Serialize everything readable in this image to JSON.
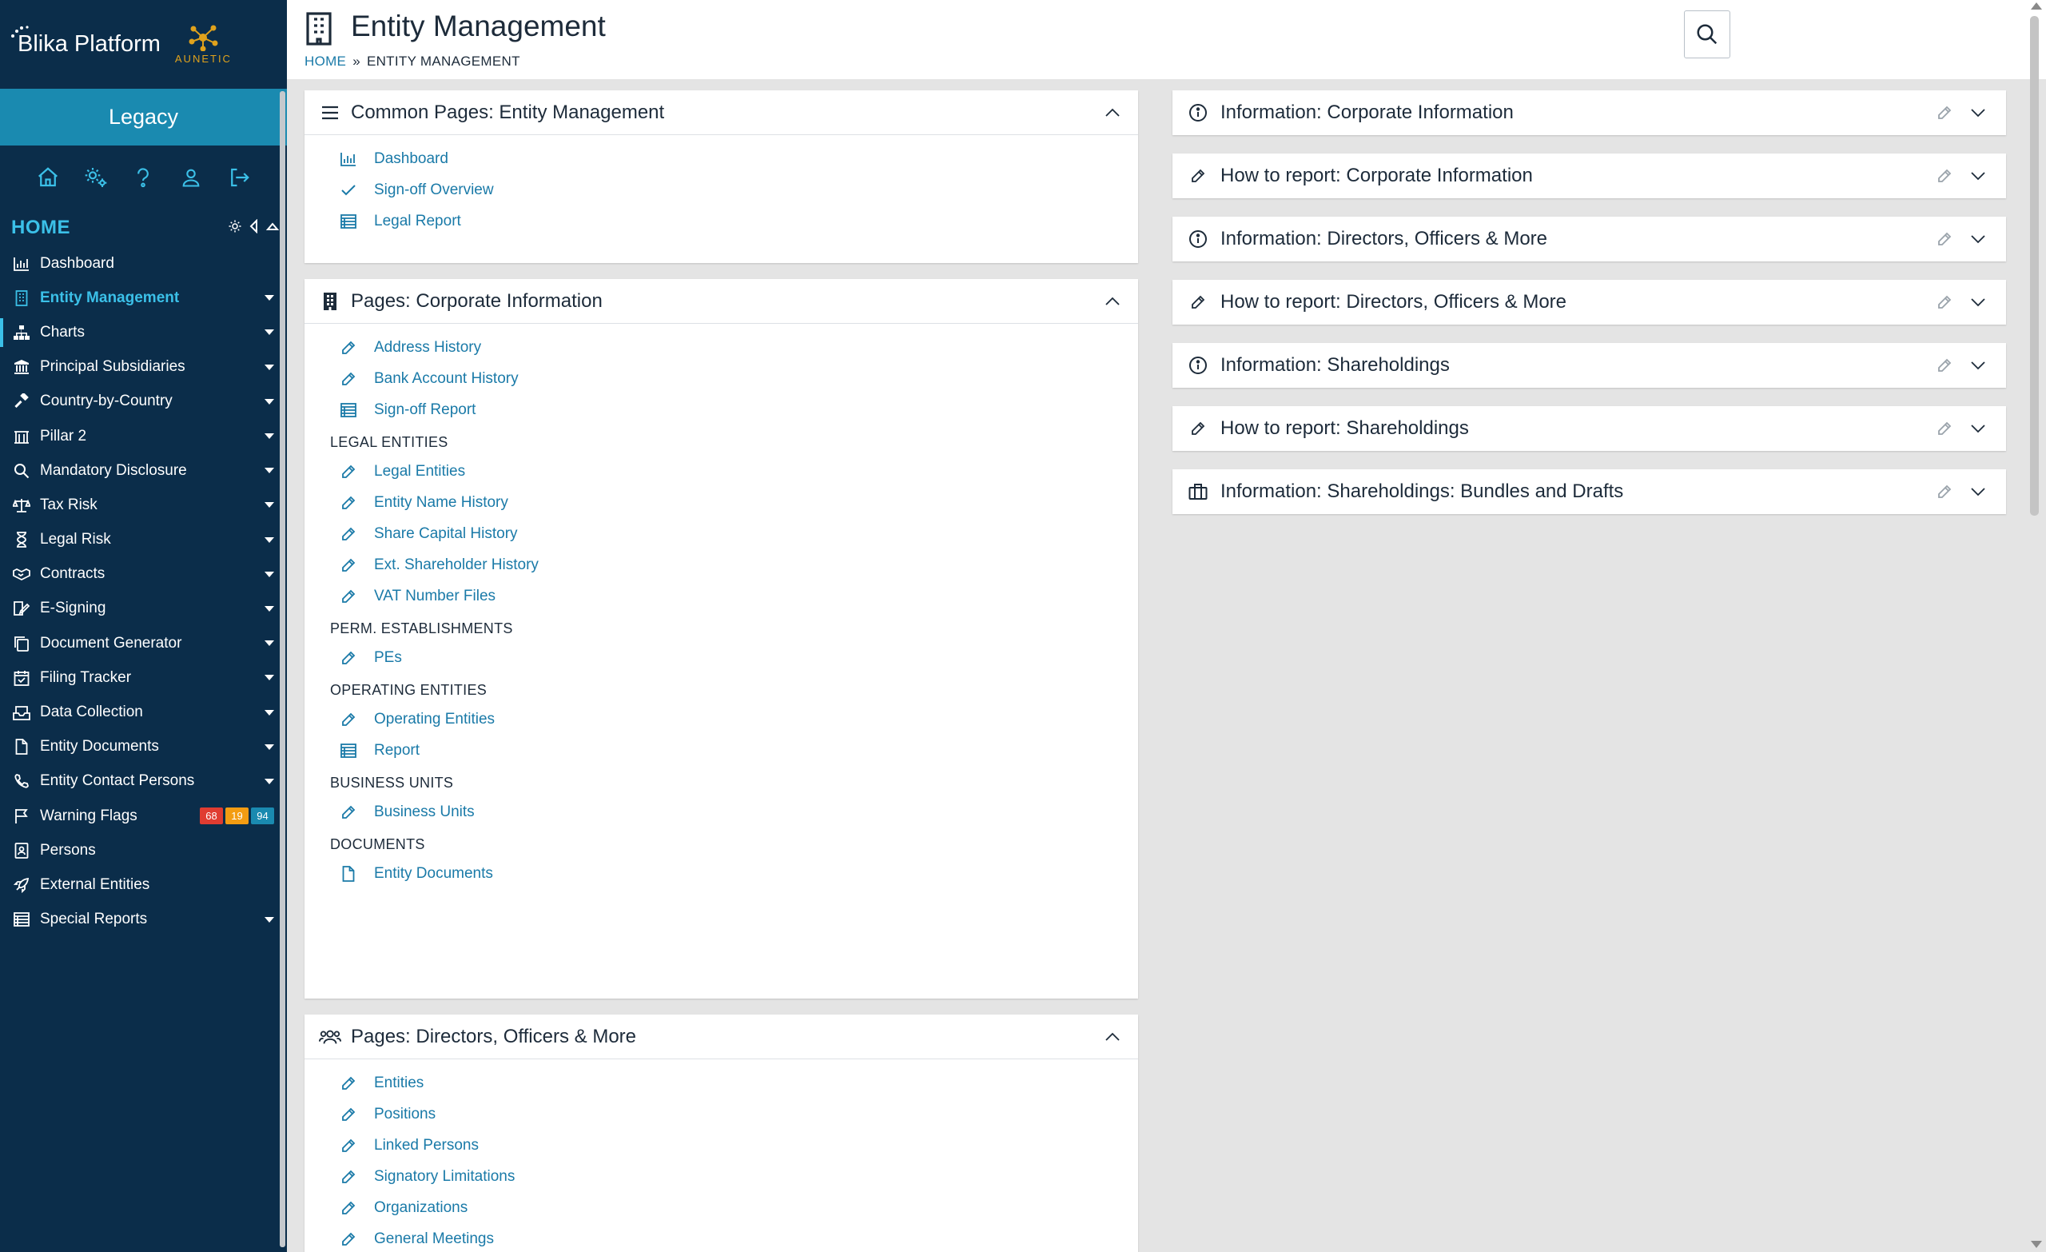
{
  "app": {
    "logo_text": "Blika Platform",
    "partner_logo_text": "AUNETIC",
    "environment_label": "Legacy"
  },
  "colors": {
    "sidebar_bg": "#0b2d4a",
    "legacy_bar": "#1a8ab0",
    "accent": "#3bc0e8",
    "link": "#1a7aa8",
    "badge_red": "#e03c31",
    "badge_orange": "#f39c12",
    "badge_blue": "#1a8ab0"
  },
  "sidebar": {
    "top_icons": [
      "home-icon",
      "settings-icon",
      "help-icon",
      "user-icon",
      "logout-icon"
    ],
    "home_label": "HOME",
    "items": [
      {
        "label": "Dashboard",
        "icon": "chart-icon",
        "expandable": false
      },
      {
        "label": "Entity Management",
        "icon": "building-icon",
        "expandable": true,
        "active": true
      },
      {
        "label": "Charts",
        "icon": "org-chart-icon",
        "expandable": true
      },
      {
        "label": "Principal Subsidiaries",
        "icon": "bank-icon",
        "expandable": true
      },
      {
        "label": "Country-by-Country",
        "icon": "gavel-icon",
        "expandable": true
      },
      {
        "label": "Pillar 2",
        "icon": "pillar-icon",
        "expandable": true
      },
      {
        "label": "Mandatory Disclosure",
        "icon": "magnifier-icon",
        "expandable": true
      },
      {
        "label": "Tax Risk",
        "icon": "scales-icon",
        "expandable": true
      },
      {
        "label": "Legal Risk",
        "icon": "hourglass-icon",
        "expandable": true
      },
      {
        "label": "Contracts",
        "icon": "handshake-icon",
        "expandable": true
      },
      {
        "label": "E-Signing",
        "icon": "sign-icon",
        "expandable": true
      },
      {
        "label": "Document Generator",
        "icon": "copy-icon",
        "expandable": true
      },
      {
        "label": "Filing Tracker",
        "icon": "calendar-icon",
        "expandable": true
      },
      {
        "label": "Data Collection",
        "icon": "inbox-icon",
        "expandable": true
      },
      {
        "label": "Entity Documents",
        "icon": "file-icon",
        "expandable": true
      },
      {
        "label": "Entity Contact Persons",
        "icon": "phone-icon",
        "expandable": true
      },
      {
        "label": "Warning Flags",
        "icon": "flag-icon",
        "expandable": false,
        "badges": [
          "68",
          "19",
          "94"
        ]
      },
      {
        "label": "Persons",
        "icon": "id-card-icon",
        "expandable": false
      },
      {
        "label": "External Entities",
        "icon": "rocket-icon",
        "expandable": false
      },
      {
        "label": "Special Reports",
        "icon": "table-icon",
        "expandable": true
      }
    ]
  },
  "header": {
    "title": "Entity Management",
    "breadcrumb_home": "HOME",
    "breadcrumb_sep": "»",
    "breadcrumb_current": "ENTITY MANAGEMENT"
  },
  "panels": {
    "common": {
      "title": "Common Pages: Entity Management",
      "links": [
        {
          "label": "Dashboard",
          "icon": "chart-icon"
        },
        {
          "label": "Sign-off Overview",
          "icon": "check-icon"
        },
        {
          "label": "Legal Report",
          "icon": "table-icon"
        }
      ]
    },
    "corporate": {
      "title": "Pages: Corporate Information",
      "links": [
        {
          "label": "Address History",
          "icon": "pencil-icon"
        },
        {
          "label": "Bank Account History",
          "icon": "pencil-icon"
        },
        {
          "label": "Sign-off Report",
          "icon": "table-icon"
        }
      ],
      "sections": [
        {
          "label": "LEGAL ENTITIES",
          "links": [
            {
              "label": "Legal Entities",
              "icon": "pencil-icon"
            },
            {
              "label": "Entity Name History",
              "icon": "pencil-icon"
            },
            {
              "label": "Share Capital History",
              "icon": "pencil-icon"
            },
            {
              "label": "Ext. Shareholder History",
              "icon": "pencil-icon"
            },
            {
              "label": "VAT Number Files",
              "icon": "pencil-icon"
            }
          ]
        },
        {
          "label": "PERM. ESTABLISHMENTS",
          "links": [
            {
              "label": "PEs",
              "icon": "pencil-icon"
            }
          ]
        },
        {
          "label": "OPERATING ENTITIES",
          "links": [
            {
              "label": "Operating Entities",
              "icon": "pencil-icon"
            },
            {
              "label": "Report",
              "icon": "table-icon"
            }
          ]
        },
        {
          "label": "BUSINESS UNITS",
          "links": [
            {
              "label": "Business Units",
              "icon": "pencil-icon"
            }
          ]
        },
        {
          "label": "DOCUMENTS",
          "links": [
            {
              "label": "Entity Documents",
              "icon": "file-icon"
            }
          ]
        }
      ]
    },
    "directors": {
      "title": "Pages: Directors, Officers & More",
      "links": [
        {
          "label": "Entities",
          "icon": "pencil-icon"
        },
        {
          "label": "Positions",
          "icon": "pencil-icon"
        },
        {
          "label": "Linked Persons",
          "icon": "pencil-icon"
        },
        {
          "label": "Signatory Limitations",
          "icon": "pencil-icon"
        },
        {
          "label": "Organizations",
          "icon": "pencil-icon"
        },
        {
          "label": "General Meetings",
          "icon": "pencil-icon"
        }
      ]
    }
  },
  "accordions": [
    {
      "title": "Information: Corporate Information",
      "icon": "info-icon"
    },
    {
      "title": "How to report: Corporate Information",
      "icon": "pencil-icon"
    },
    {
      "title": "Information: Directors, Officers & More",
      "icon": "info-icon"
    },
    {
      "title": "How to report: Directors, Officers & More",
      "icon": "pencil-icon"
    },
    {
      "title": "Information: Shareholdings",
      "icon": "info-icon"
    },
    {
      "title": "How to report: Shareholdings",
      "icon": "pencil-icon"
    },
    {
      "title": "Information: Shareholdings: Bundles and Drafts",
      "icon": "briefcase-icon"
    }
  ]
}
